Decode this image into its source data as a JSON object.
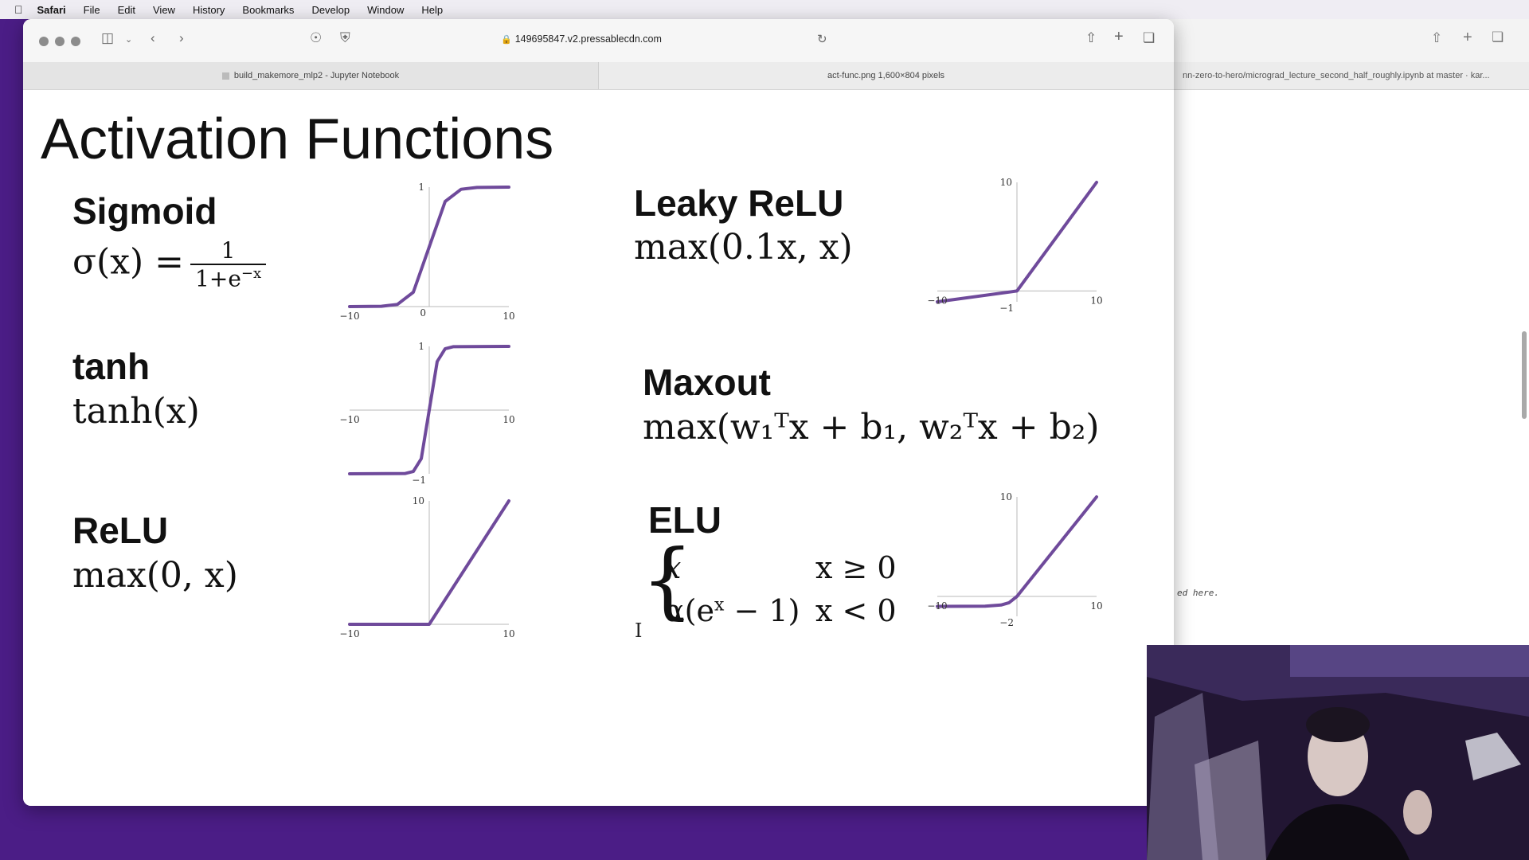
{
  "menubar": {
    "apple": "",
    "app": "Safari",
    "items": [
      "File",
      "Edit",
      "View",
      "History",
      "Bookmarks",
      "Develop",
      "Window",
      "Help"
    ]
  },
  "browser": {
    "url": "149695847.v2.pressablecdn.com",
    "tabs": [
      {
        "label": "build_makemore_mlp2 - Jupyter Notebook"
      },
      {
        "label": "act-func.png 1,600×804 pixels"
      }
    ]
  },
  "background_window": {
    "tab_label": "nn-zero-to-hero/micrograd_lecture_second_half_roughly.ipynb at master · kar...",
    "note": "ed here."
  },
  "slide": {
    "title": "Activation Functions",
    "sections": {
      "sigmoid": {
        "name": "Sigmoid",
        "formula_lhs": "σ(x) =",
        "formula_num": "1",
        "formula_den": "1+e",
        "formula_exp": "−x"
      },
      "tanh": {
        "name": "tanh",
        "formula": "tanh(x)"
      },
      "relu": {
        "name": "ReLU",
        "formula": "max(0, x)"
      },
      "leaky": {
        "name": "Leaky ReLU",
        "formula": "max(0.1x, x)"
      },
      "maxout": {
        "name": "Maxout",
        "formula": "max(w₁ᵀx + b₁, w₂ᵀx + b₂)"
      },
      "elu": {
        "name": "ELU",
        "case1_expr": "x",
        "case1_cond": "x ≥ 0",
        "case2_pre": "α(e",
        "case2_exp": "x",
        "case2_post": " − 1)",
        "case2_cond": "x < 0"
      }
    }
  },
  "chart_data": [
    {
      "type": "line",
      "name": "Sigmoid",
      "xlim": [
        -10,
        10
      ],
      "ylim": [
        0,
        1
      ],
      "tick_labels": {
        "xmin": "−10",
        "xmax": "10",
        "ytop": "1",
        "ybottom": "0"
      },
      "x": [
        -10,
        -6,
        -4,
        -2,
        0,
        2,
        4,
        6,
        10
      ],
      "y": [
        5e-05,
        0.0025,
        0.018,
        0.12,
        0.5,
        0.88,
        0.982,
        0.9975,
        0.99995
      ]
    },
    {
      "type": "line",
      "name": "tanh",
      "xlim": [
        -10,
        10
      ],
      "ylim": [
        -1,
        1
      ],
      "tick_labels": {
        "xmin": "−10",
        "xmax": "10",
        "ytop": "1",
        "ybottom": "−1"
      },
      "x": [
        -10,
        -3,
        -2,
        -1,
        0,
        1,
        2,
        3,
        10
      ],
      "y": [
        -1,
        -0.995,
        -0.964,
        -0.762,
        0,
        0.762,
        0.964,
        0.995,
        1
      ]
    },
    {
      "type": "line",
      "name": "ReLU",
      "xlim": [
        -10,
        10
      ],
      "ylim": [
        0,
        10
      ],
      "tick_labels": {
        "xmin": "−10",
        "xmax": "10",
        "ytop": "10"
      },
      "x": [
        -10,
        0,
        10
      ],
      "y": [
        0,
        0,
        10
      ]
    },
    {
      "type": "line",
      "name": "Leaky ReLU",
      "xlim": [
        -10,
        10
      ],
      "ylim": [
        -1,
        10
      ],
      "tick_labels": {
        "xmin": "−10",
        "xmax": "10",
        "ytop": "10",
        "ybottom": "−1"
      },
      "x": [
        -10,
        0,
        10
      ],
      "y": [
        -1,
        0,
        10
      ]
    },
    {
      "type": "line",
      "name": "ELU",
      "xlim": [
        -10,
        10
      ],
      "ylim": [
        -2,
        10
      ],
      "tick_labels": {
        "xmin": "−10",
        "xmax": "10",
        "ytop": "10",
        "ybottom": "−2"
      },
      "x": [
        -10,
        -4,
        -2,
        -1,
        0,
        10
      ],
      "y": [
        -0.99995,
        -0.98,
        -0.86,
        -0.63,
        0,
        10
      ]
    }
  ],
  "colors": {
    "curve": "#6f4a9b",
    "axis": "#b8b8b8",
    "desktop": "#4b1d86"
  }
}
